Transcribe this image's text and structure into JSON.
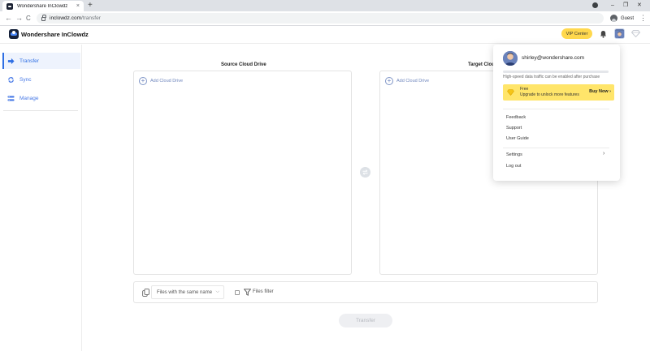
{
  "browser": {
    "tab_title": "Wondershare InClowdz",
    "tab_close": "×",
    "new_tab": "+",
    "back": "←",
    "forward": "→",
    "reload": "C",
    "url_host": "inclowdz.com",
    "url_path": "/transfer",
    "profile_label": "Guest",
    "menu": "⋮",
    "minimize": "–",
    "maximize": "❐",
    "close": "✕"
  },
  "app": {
    "brand_name": "Wondershare InClowdz",
    "vip_label": "VIP Center",
    "accent_color": "#2f6fe4",
    "vip_color": "#ffd84d"
  },
  "sidebar": {
    "items": [
      {
        "label": "Transfer",
        "icon": "transfer-icon",
        "active": true
      },
      {
        "label": "Sync",
        "icon": "sync-icon",
        "active": false
      },
      {
        "label": "Manage",
        "icon": "manage-icon",
        "active": false
      }
    ]
  },
  "main": {
    "source_title": "Source Cloud Drive",
    "target_title": "Target Cloud Drive",
    "add_drive_label": "Add Cloud Drive",
    "duplicate_option": "Files with the same name",
    "filter_label": "Files filter",
    "transfer_button": "Transfer"
  },
  "account_menu": {
    "email": "shirley@wondershare.com",
    "traffic_note": "High-speed data traffic can be enabled after purchase",
    "traffic_used_fraction": 0,
    "plan_name": "Free",
    "plan_upsell": "Upgrade to unlock more features",
    "buy_now": "Buy Now",
    "items": [
      "Feedback",
      "Support",
      "User Guide",
      "Settings",
      "Log out"
    ]
  }
}
